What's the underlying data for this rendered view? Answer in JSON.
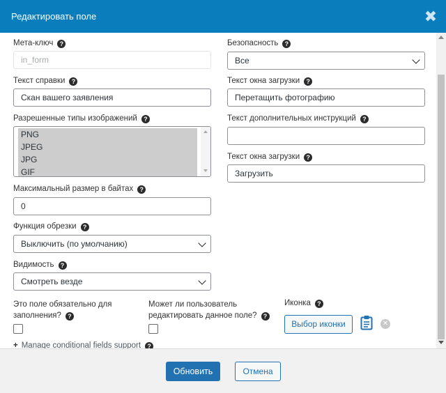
{
  "modal": {
    "title": "Редактировать поле",
    "close_symbol": "✖"
  },
  "fields": {
    "meta_key": {
      "label": "Мета-ключ",
      "value": "in_form"
    },
    "help_text": {
      "label": "Текст справки",
      "value": "Скан вашего заявления"
    },
    "allowed_types": {
      "label": "Разрешенные типы изображений",
      "options": [
        "PNG",
        "JPEG",
        "JPG",
        "GIF"
      ]
    },
    "max_size": {
      "label": "Максимальный размер в байтах",
      "value": "0"
    },
    "crop": {
      "label": "Функция обрезки",
      "value": "Выключить (по умолчанию)"
    },
    "visibility": {
      "label": "Видимость",
      "value": "Смотреть везде"
    },
    "security": {
      "label": "Безопасность",
      "value": "Все"
    },
    "upload_text": {
      "label": "Текст окна загрузки",
      "value": "Перетащить фотографию"
    },
    "extra_instructions": {
      "label": "Текст дополнительных инструкций",
      "value": ""
    },
    "upload_text2": {
      "label": "Текст окна загрузки",
      "value": "Загрузить"
    },
    "required": {
      "label_line1": "Это поле обязательно для",
      "label_line2": "заполнения?",
      "checked": false
    },
    "editable": {
      "label_line1": "Может ли пользователь",
      "label_line2": "редактировать данное поле?",
      "checked": false
    },
    "icon": {
      "label": "Иконка",
      "button": "Выбор иконки"
    }
  },
  "manage_link": {
    "plus": "+",
    "text": "Manage conditional fields support"
  },
  "help_glyph": "?",
  "remove_glyph": "✕",
  "footer": {
    "update": "Обновить",
    "cancel": "Отмена"
  },
  "colors": {
    "header": "#0a7ebd",
    "primary": "#2271b1",
    "footer_bg": "#f1f1f1"
  }
}
